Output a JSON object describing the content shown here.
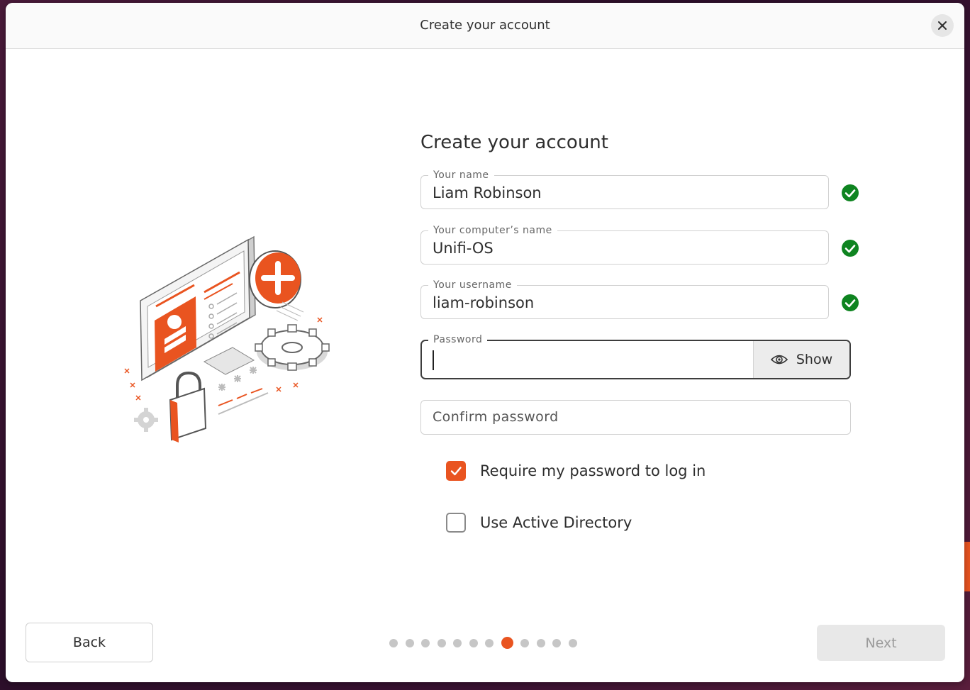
{
  "window": {
    "title": "Create your account"
  },
  "form": {
    "heading": "Create your account",
    "name": {
      "label": "Your name",
      "value": "Liam Robinson",
      "valid": true
    },
    "computer": {
      "label": "Your computer’s name",
      "value": "Unifi-OS",
      "valid": true
    },
    "username": {
      "label": "Your username",
      "value": "liam-robinson",
      "valid": true
    },
    "password": {
      "label": "Password",
      "value": "",
      "show_label": "Show"
    },
    "confirm": {
      "placeholder": "Confirm password",
      "value": ""
    },
    "require_password": {
      "label": "Require my password to log in",
      "checked": true
    },
    "active_directory": {
      "label": "Use Active Directory",
      "checked": false
    }
  },
  "footer": {
    "back_label": "Back",
    "next_label": "Next",
    "next_enabled": false,
    "progress": {
      "total_steps": 12,
      "current_step": 8
    }
  },
  "icons": {
    "close": "close-icon",
    "valid": "check-circle-icon",
    "show": "eye-icon",
    "checkbox": "checkmark-icon"
  },
  "colors": {
    "accent": "#e95420",
    "valid": "#0e8420",
    "disabled_text": "#9a9a9a"
  }
}
